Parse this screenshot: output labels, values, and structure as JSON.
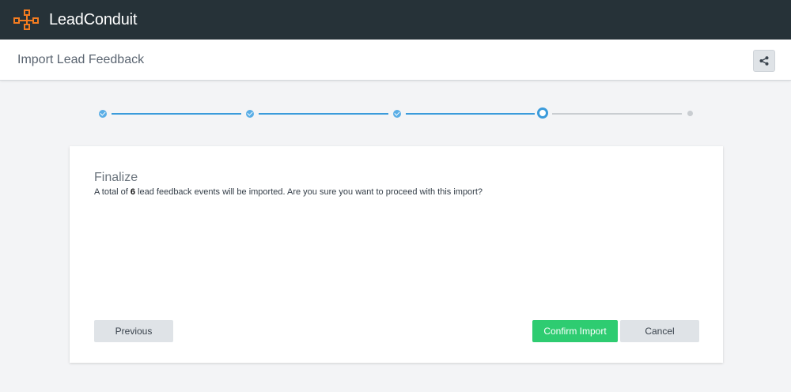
{
  "app": {
    "brand": "LeadConduit",
    "logo_icon": "network-nodes-icon",
    "accent_color": "#f47c20"
  },
  "header": {
    "title": "Import Lead Feedback",
    "share_icon": "share-icon"
  },
  "stepper": {
    "steps": [
      {
        "state": "complete"
      },
      {
        "state": "complete"
      },
      {
        "state": "complete"
      },
      {
        "state": "current"
      },
      {
        "state": "upcoming"
      }
    ],
    "active_color": "#3b9bdb"
  },
  "dialog": {
    "title": "Finalize",
    "message_prefix": "A total of ",
    "event_count": "6",
    "message_suffix": " lead feedback events will be imported. Are you sure you want to proceed with this import?",
    "previous_label": "Previous",
    "confirm_label": "Confirm Import",
    "cancel_label": "Cancel",
    "confirm_color": "#2ecc71"
  }
}
